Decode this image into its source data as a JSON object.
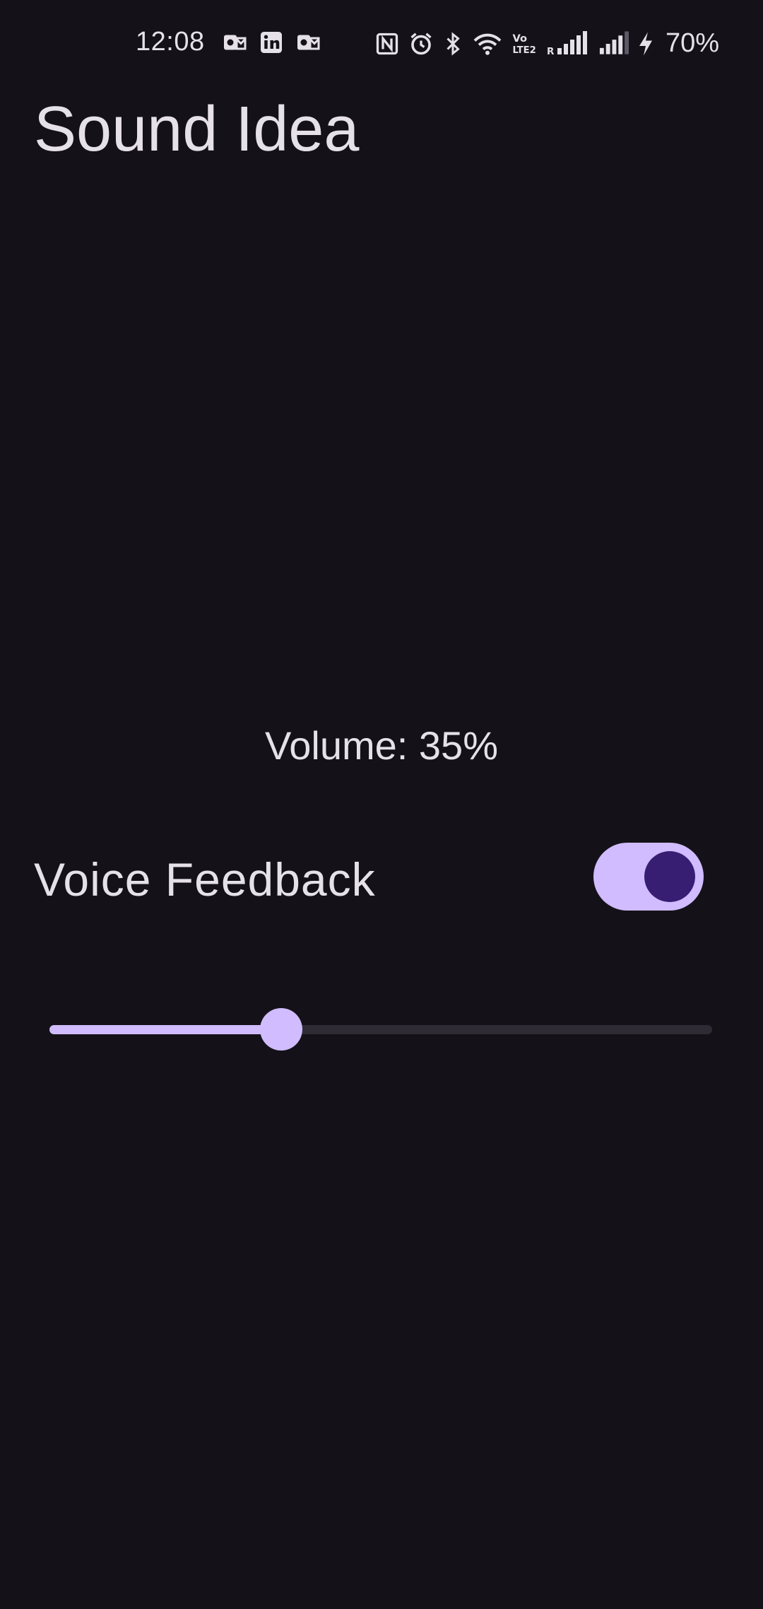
{
  "status_bar": {
    "time": "12:08",
    "battery": "70%",
    "notification_icons": [
      "outlook-icon",
      "linkedin-icon",
      "outlook-icon"
    ],
    "system_icons": [
      "nfc-icon",
      "alarm-icon",
      "bluetooth-icon",
      "wifi-icon",
      "volte-icon",
      "signal-icon",
      "signal-icon",
      "charging-icon"
    ]
  },
  "app": {
    "title": "Sound Idea"
  },
  "volume": {
    "label": "Volume: 35%",
    "value": 0.35
  },
  "voice_feedback": {
    "label": "Voice Feedback",
    "enabled": true
  },
  "colors": {
    "background": "#141218",
    "accent": "#d0bcff",
    "accent_dark": "#381e72",
    "text": "#e6e0e9",
    "track_inactive": "#2f2b35"
  }
}
